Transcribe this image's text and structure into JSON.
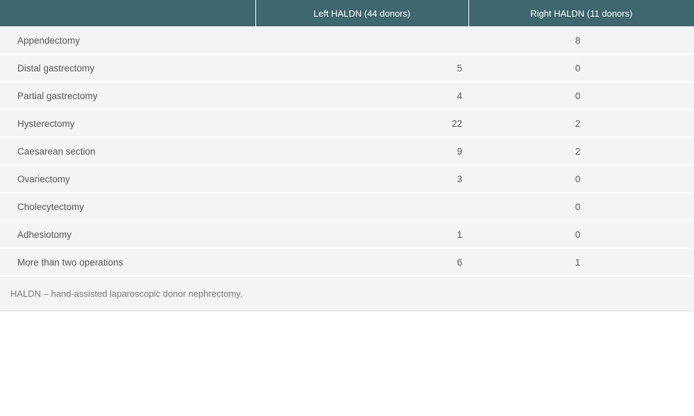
{
  "table": {
    "headers": [
      "",
      "Left HALDN (44 donors)",
      "Right HALDN (11 donors)"
    ],
    "rows": [
      {
        "label": "Appendectomy",
        "left": "",
        "right": "8"
      },
      {
        "label": "Distal gastrectomy",
        "left": "5",
        "right": "0"
      },
      {
        "label": "Partial gastrectomy",
        "left": "4",
        "right": "0"
      },
      {
        "label": "Hysterectomy",
        "left": "22",
        "right": "2"
      },
      {
        "label": "Caesarean section",
        "left": "9",
        "right": "2"
      },
      {
        "label": "Ovariectomy",
        "left": "3",
        "right": "0"
      },
      {
        "label": "Cholecytectomy",
        "left": "",
        "right": "0"
      },
      {
        "label": "Adhesiotomy",
        "left": "1",
        "right": "0"
      },
      {
        "label": "More than two operations",
        "left": "6",
        "right": "1"
      }
    ],
    "footnote": "HALDN – hand-assisted laparoscopic donor nephrectomy."
  },
  "colors": {
    "header_bg": "#3e6770",
    "row_bg": "#f4f4f4"
  }
}
